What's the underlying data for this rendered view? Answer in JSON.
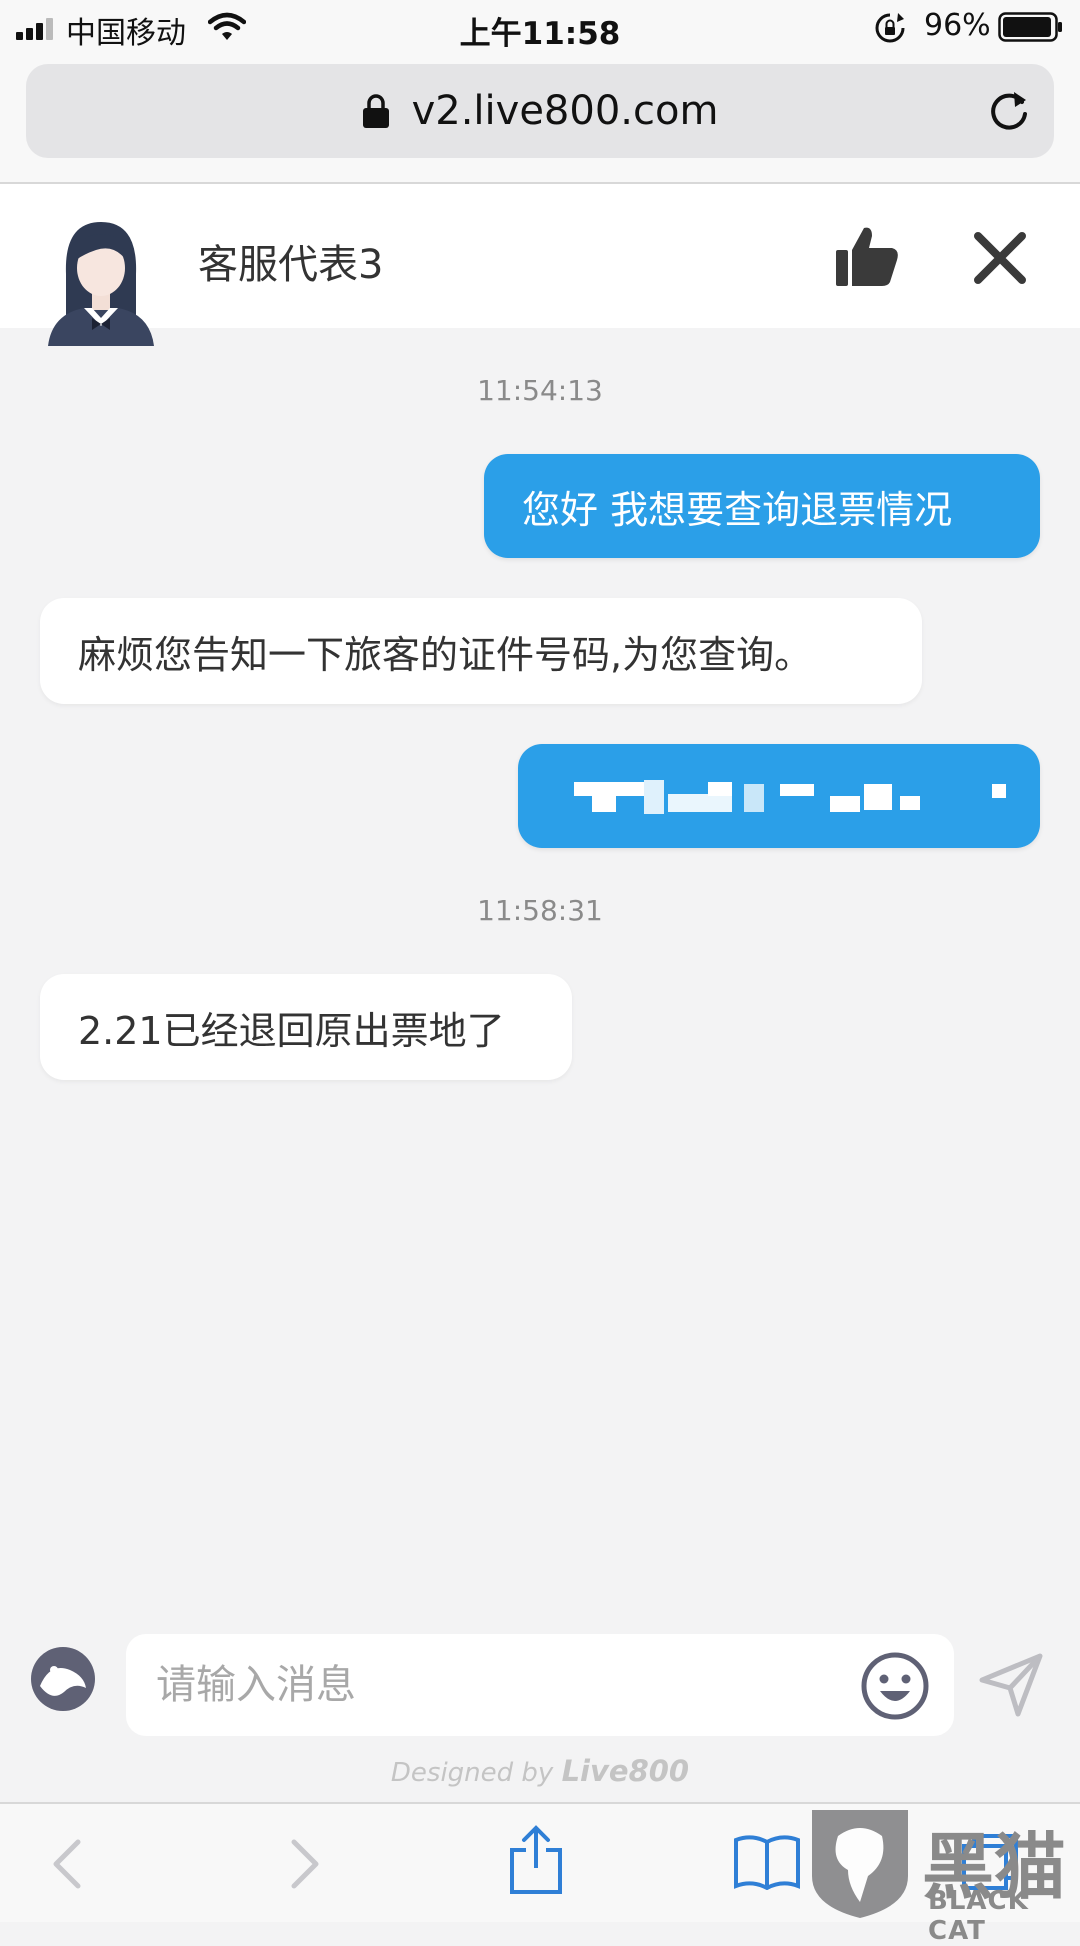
{
  "status_bar": {
    "carrier": "中国移动",
    "time": "上午11:58",
    "battery_percent": "96%",
    "battery_level": 0.96
  },
  "browser": {
    "url": "v2.live800.com"
  },
  "chat": {
    "agent_name": "客服代表3",
    "messages": [
      {
        "type": "timestamp",
        "text": "11:54:13"
      },
      {
        "type": "outgoing",
        "text": "您好 我想要查询退票情况"
      },
      {
        "type": "incoming",
        "text": "麻烦您告知一下旅客的证件号码,为您查询。"
      },
      {
        "type": "outgoing",
        "text": ""
      },
      {
        "type": "timestamp",
        "text": "11:58:31"
      },
      {
        "type": "incoming",
        "text": "2.21已经退回原出票地了"
      }
    ]
  },
  "composer": {
    "placeholder": "请输入消息"
  },
  "footer": {
    "designed_by": "Designed by",
    "brand": "Live800"
  },
  "watermark": {
    "cn": "黑猫",
    "en": "BLACK CAT"
  },
  "colors": {
    "outgoing_bubble": "#2b9fe8",
    "incoming_bubble": "#ffffff",
    "chat_background": "#f3f3f4",
    "toolbar_icon": "#2f7fd6"
  },
  "icons": [
    "signal-icon",
    "wifi-icon",
    "rotation-lock-icon",
    "battery-icon",
    "lock-icon",
    "reload-icon",
    "avatar",
    "thumbs-up-icon",
    "close-icon",
    "theme-icon",
    "smiley-icon",
    "send-icon",
    "back-icon",
    "forward-icon",
    "share-icon",
    "bookmarks-icon",
    "tabs-icon"
  ]
}
